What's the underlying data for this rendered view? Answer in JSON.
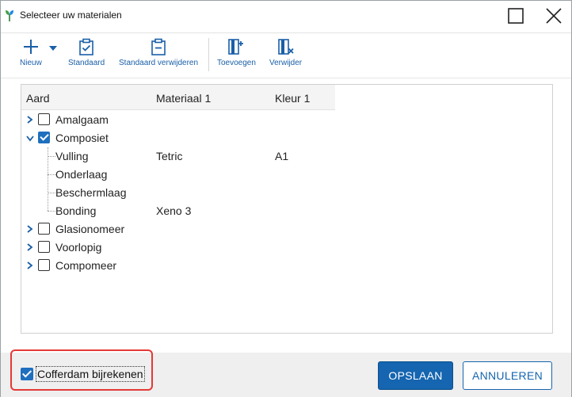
{
  "window": {
    "title": "Selecteer uw materialen"
  },
  "toolbar": {
    "new_label": "Nieuw",
    "standard_label": "Standaard",
    "remove_standard_label": "Standaard verwijderen",
    "add_label": "Toevoegen",
    "delete_label": "Verwijder"
  },
  "grid": {
    "columns": [
      "Aard",
      "Materiaal 1",
      "Kleur 1"
    ],
    "rows": [
      {
        "name": "Amalgaam",
        "level": 0,
        "expanded": false,
        "checked": false,
        "material": "",
        "color": ""
      },
      {
        "name": "Composiet",
        "level": 0,
        "expanded": true,
        "checked": true,
        "material": "",
        "color": ""
      },
      {
        "name": "Vulling",
        "level": 1,
        "material": "Tetric",
        "color": "A1"
      },
      {
        "name": "Onderlaag",
        "level": 1,
        "material": "",
        "color": ""
      },
      {
        "name": "Beschermlaag",
        "level": 1,
        "material": "",
        "color": ""
      },
      {
        "name": "Bonding",
        "level": 1,
        "material": "Xeno 3",
        "color": ""
      },
      {
        "name": "Glasionomeer",
        "level": 0,
        "expanded": false,
        "checked": false,
        "material": "",
        "color": ""
      },
      {
        "name": "Voorlopig",
        "level": 0,
        "expanded": false,
        "checked": false,
        "material": "",
        "color": ""
      },
      {
        "name": "Compomeer",
        "level": 0,
        "expanded": false,
        "checked": false,
        "material": "",
        "color": ""
      }
    ]
  },
  "footer": {
    "cofferdam_label": "Cofferdam bijrekenen",
    "cofferdam_checked": true,
    "save_label": "OPSLAAN",
    "cancel_label": "ANNULEREN"
  },
  "colors": {
    "accent": "#1565b0",
    "highlight": "#e53935",
    "checkbox": "#1f6fbf"
  }
}
